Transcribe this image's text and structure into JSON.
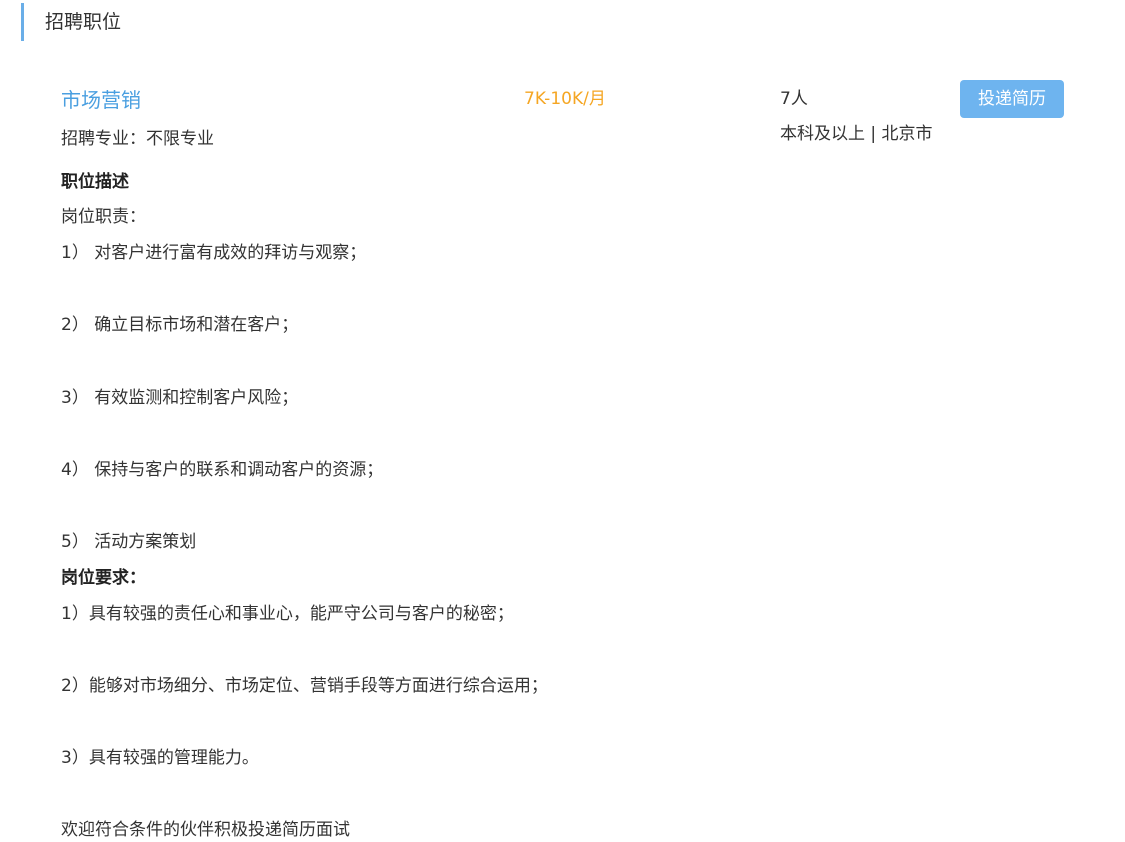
{
  "section": {
    "title": "招聘职位"
  },
  "job": {
    "title": "市场营销",
    "salary": "7K-10K/月",
    "headcount": "7人",
    "apply_label": "投递简历",
    "major": "招聘专业：不限专业",
    "edu_location": "本科及以上 | 北京市"
  },
  "description": {
    "heading": "职位描述",
    "duties_label": "岗位职责：",
    "duties": [
      "1）  对客户进行富有成效的拜访与观察；",
      "2）  确立目标市场和潜在客户；",
      "3）  有效监测和控制客户风险；",
      "4）  保持与客户的联系和调动客户的资源；",
      "5）  活动方案策划"
    ],
    "requirements_label": "岗位要求：",
    "requirements": [
      "1）具有较强的责任心和事业心，能严守公司与客户的秘密；",
      "2）能够对市场细分、市场定位、营销手段等方面进行综合运用；",
      "3）具有较强的管理能力。"
    ],
    "closing": "欢迎符合条件的伙伴积极投递简历面试"
  }
}
